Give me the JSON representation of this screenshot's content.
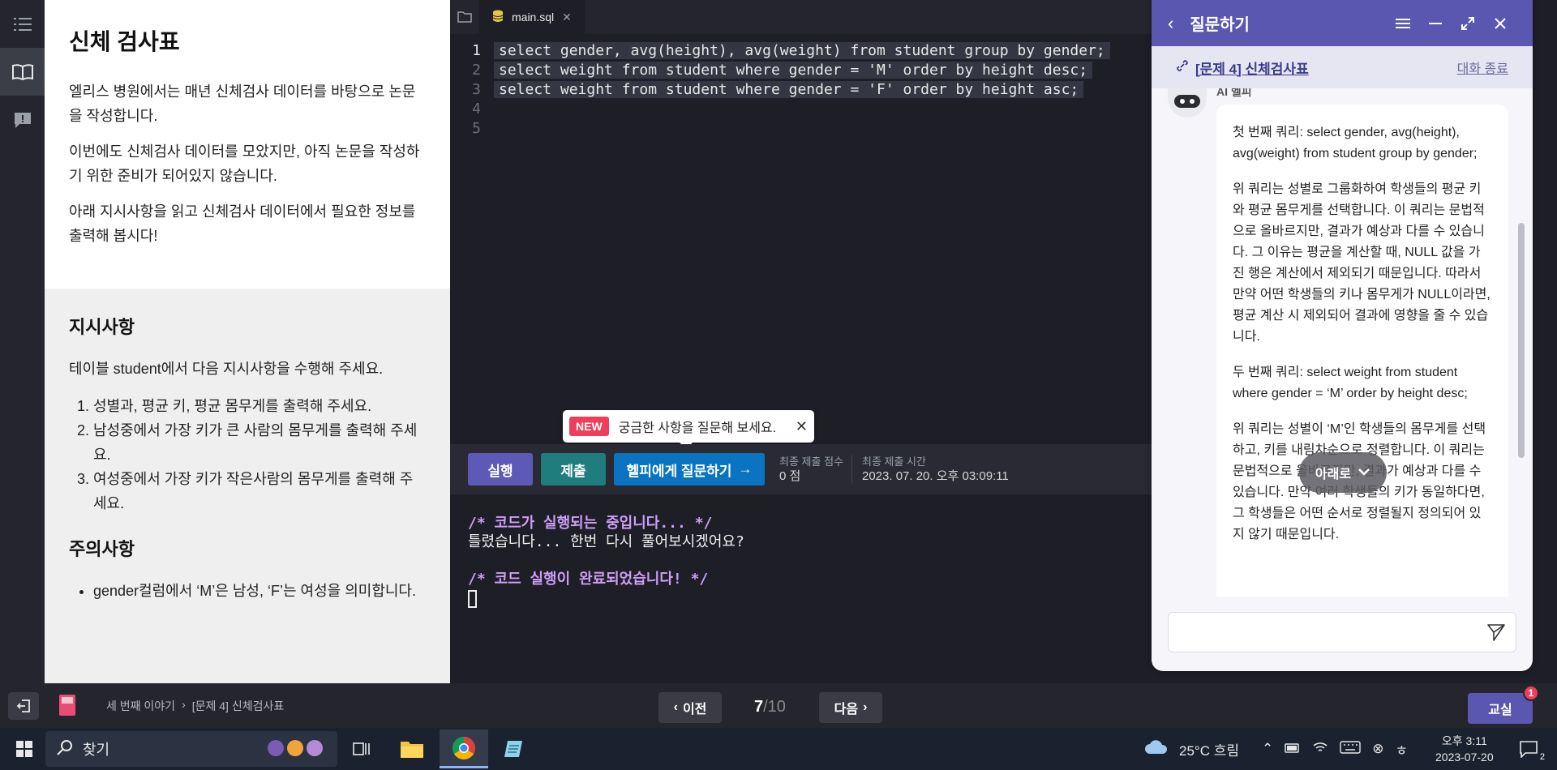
{
  "description": {
    "title": "신체 검사표",
    "paragraphs": [
      "엘리스 병원에서는 매년 신체검사 데이터를 바탕으로 논문을 작성합니다.",
      "이번에도 신체검사 데이터를 모았지만, 아직 논문을 작성하기 위한 준비가 되어있지 않습니다.",
      "아래 지시사항을 읽고 신체검사 데이터에서 필요한 정보를 출력해 봅시다!"
    ],
    "instructions_heading": "지시사항",
    "instructions_intro": "테이블 student에서 다음 지시사항을 수행해 주세요.",
    "instructions": [
      "성별과, 평균 키, 평균 몸무게를 출력해 주세요.",
      "남성중에서 가장 키가 큰 사람의 몸무게를 출력해 주세요.",
      "여성중에서 가장 키가 작은사람의 몸무게를 출력해 주세요."
    ],
    "notes_heading": "주의사항",
    "notes": [
      "gender컬럼에서 ‘M’은 남성, ‘F’는 여성을 의미합니다."
    ]
  },
  "editor": {
    "tab_name": "main.sql",
    "lines": [
      {
        "no": "1",
        "text": "select gender, avg(height), avg(weight) from student group by gender;"
      },
      {
        "no": "2",
        "text": "select weight from student where gender = 'M' order by height desc;"
      },
      {
        "no": "3",
        "text": "select weight from student where gender = 'F' order by height asc;"
      },
      {
        "no": "4",
        "text": ""
      },
      {
        "no": "5",
        "text": ""
      }
    ]
  },
  "tooltip": {
    "badge": "NEW",
    "message": "궁금한 사항을 질문해 보세요."
  },
  "actions": {
    "run": "실행",
    "submit": "제출",
    "ask": "헬피에게 질문하기",
    "score_label": "최종 제출 점수",
    "score_value": "0 점",
    "time_label": "최종 제출 시간",
    "time_value": "2023. 07. 20. 오후 03:09:11"
  },
  "console": {
    "start": "/* 코드가 실행되는 중입니다... */",
    "output": "틀렸습니다... 한번 다시 풀어보시겠어요?",
    "end": "/* 코드 실행이 완료되었습니다! */"
  },
  "chat": {
    "title": "질문하기",
    "link": "[문제 4] 신체검사표",
    "end_chat": "대화 종료",
    "ai_name": "AI 헬피",
    "messages": [
      "첫 번째 쿼리: select gender, avg(height), avg(weight) from student group by gender;",
      "위 쿼리는 성별로 그룹화하여 학생들의 평균 키와 평균 몸무게를 선택합니다. 이 쿼리는 문법적으로 올바르지만, 결과가 예상과 다를 수 있습니다. 그 이유는 평균을 계산할 때, NULL 값을 가진 행은 계산에서 제외되기 때문입니다. 따라서 만약 어떤 학생들의 키나 몸무게가 NULL이라면, 평균 계산 시 제외되어 결과에 영향을 줄 수 있습니다.",
      "두 번째 쿼리: select weight from student where gender = ‘M’ order by height desc;",
      "위 쿼리는 성별이 ‘M’인 학생들의 몸무게를 선택하고, 키를 내림차순으로 정렬합니다. 이 쿼리는 문법적으로 올바르지만, 결과가 예상과 다를 수 있습니다. 만약 여러 학생들의 키가 동일하다면, 그 학생들은 어떤 순서로 정렬될지 정의되어 있지 않기 때문입니다."
    ],
    "down_button": "아래로"
  },
  "appbar": {
    "breadcrumb": [
      "세 번째 이야기",
      "[문제 4] 신체검사표"
    ],
    "prev": "이전",
    "page_current": "7",
    "page_total": "/10",
    "next": "다음",
    "classroom": "교실",
    "badge": "1"
  },
  "taskbar": {
    "search": "찾기",
    "weather": "25°C 흐림",
    "time": "오후 3:11",
    "date": "2023-07-20",
    "notifications": "2"
  }
}
